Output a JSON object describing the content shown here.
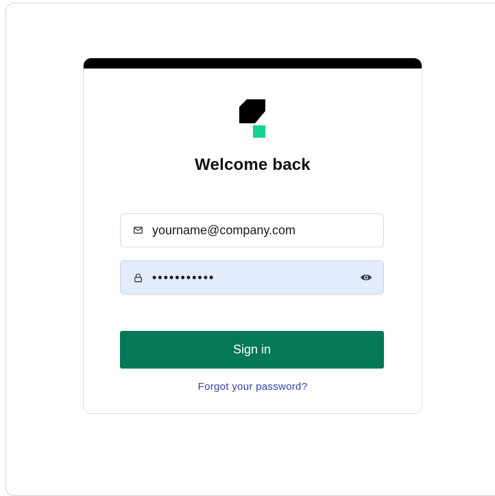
{
  "login": {
    "title": "Welcome back",
    "email": {
      "value": "yourname@company.com",
      "icon": "mail-icon"
    },
    "password": {
      "masked_value": "•••••••••••",
      "icon": "lock-icon",
      "toggle_icon": "eye-icon"
    },
    "submit_label": "Sign in",
    "forgot_label": "Forgot your password?"
  },
  "colors": {
    "accent": "#047857",
    "logo_black": "#000000",
    "logo_green": "#10d38e",
    "link": "#2f3fbf",
    "password_field_bg": "#e3ecfa"
  }
}
